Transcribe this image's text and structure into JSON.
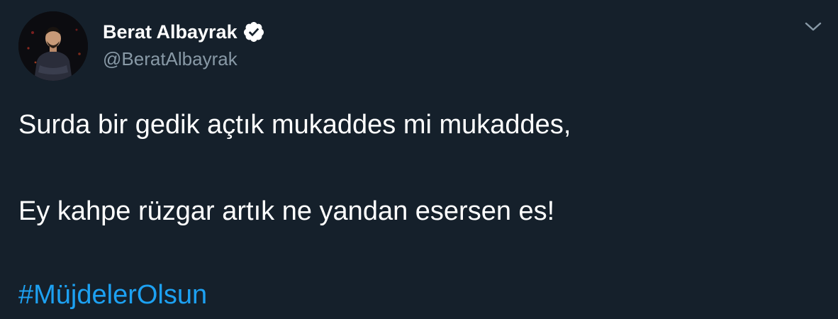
{
  "author": {
    "display_name": "Berat Albayrak",
    "handle": "@BeratAlbayrak",
    "verified": true,
    "avatar_icon": "profile-photo"
  },
  "menu": {
    "icon": "chevron-down-icon"
  },
  "tweet": {
    "line1": "Surda bir gedik açtık mukaddes mi mukaddes,",
    "line2": "Ey kahpe rüzgar artık ne yandan esersen es!",
    "hashtag": "#MüjdelerOlsun"
  },
  "colors": {
    "background": "#15202b",
    "text": "#ffffff",
    "secondary_text": "#8899a6",
    "link": "#1da1f2"
  }
}
